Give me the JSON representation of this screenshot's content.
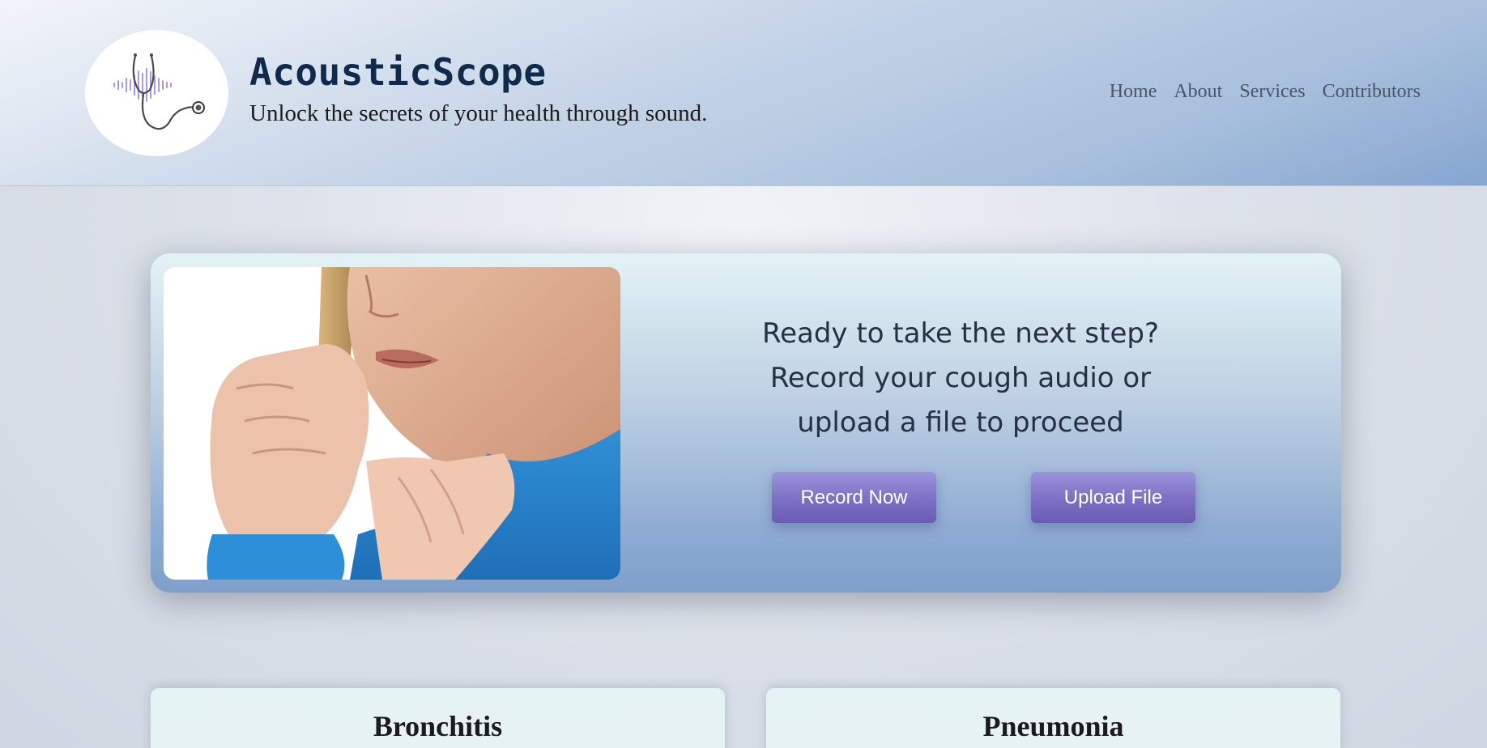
{
  "header": {
    "title": "AcousticScope",
    "tagline": "Unlock the secrets of your health through sound.",
    "logo_icon": "stethoscope-soundwave-icon",
    "nav": [
      "Home",
      "About",
      "Services",
      "Contributors"
    ]
  },
  "hero": {
    "image": "person-coughing-photo",
    "prompt_line1": "Ready to take the next step?",
    "prompt_line2": "Record your cough audio or",
    "prompt_line3": "upload a file to proceed",
    "record_label": "Record Now",
    "upload_label": "Upload File"
  },
  "cards": [
    {
      "title": "Bronchitis"
    },
    {
      "title": "Pneumonia"
    }
  ],
  "colors": {
    "brand_title": "#0e2a4d",
    "button": "#7c6fc4",
    "header_gradient_end": "#86a6cf"
  }
}
